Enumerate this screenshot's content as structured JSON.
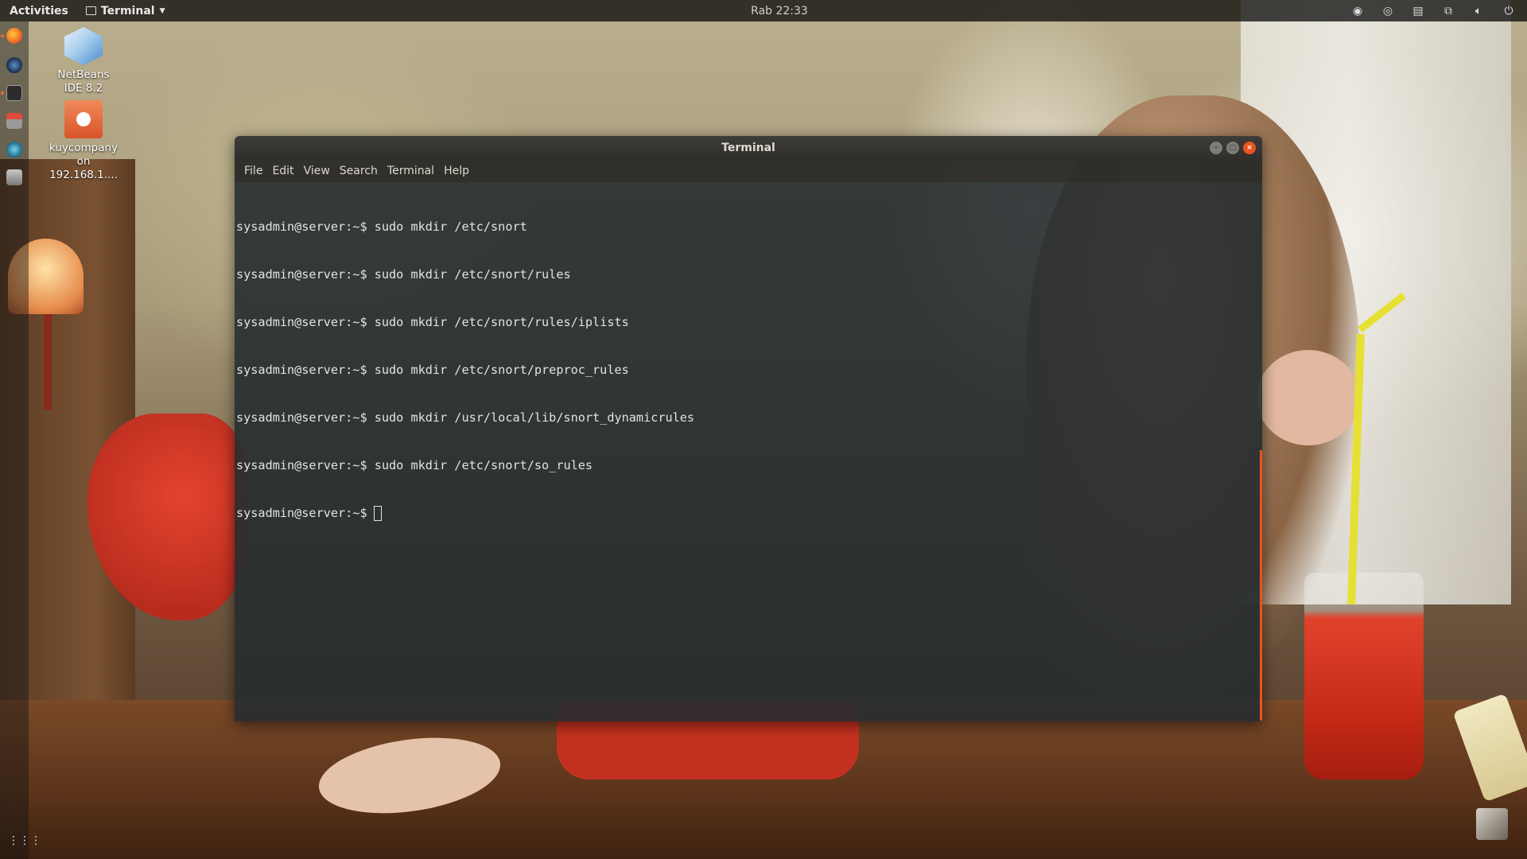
{
  "topbar": {
    "activities": "Activities",
    "app_name": "Terminal",
    "clock": "Rab 22:33",
    "tray_icons": [
      "steam-icon",
      "steam-alt-icon",
      "clipboard-icon",
      "network-icon",
      "volume-icon",
      "power-icon"
    ]
  },
  "dock": {
    "items": [
      "firefox-icon",
      "steam-icon",
      "terminal-icon",
      "system-manager-icon",
      "browser-icon",
      "archive-icon"
    ],
    "show_apps": "⋮⋮⋮"
  },
  "desktop": {
    "icons": [
      {
        "label": "NetBeans IDE 8.2",
        "icon": "netbeans-icon"
      },
      {
        "label": "kuycompany on 192.168.1....",
        "icon": "network-share-icon"
      }
    ]
  },
  "window": {
    "title": "Terminal",
    "menu": [
      "File",
      "Edit",
      "View",
      "Search",
      "Terminal",
      "Help"
    ],
    "lines": [
      "sysadmin@server:~$ sudo mkdir /etc/snort",
      "sysadmin@server:~$ sudo mkdir /etc/snort/rules",
      "sysadmin@server:~$ sudo mkdir /etc/snort/rules/iplists",
      "sysadmin@server:~$ sudo mkdir /etc/snort/preproc_rules",
      "sysadmin@server:~$ sudo mkdir /usr/local/lib/snort_dynamicrules",
      "sysadmin@server:~$ sudo mkdir /etc/snort/so_rules"
    ],
    "prompt": "sysadmin@server:~$"
  },
  "colors": {
    "accent": "#e95420",
    "terminal_bg": "#262c30",
    "terminal_fg": "#e3e3e3"
  }
}
